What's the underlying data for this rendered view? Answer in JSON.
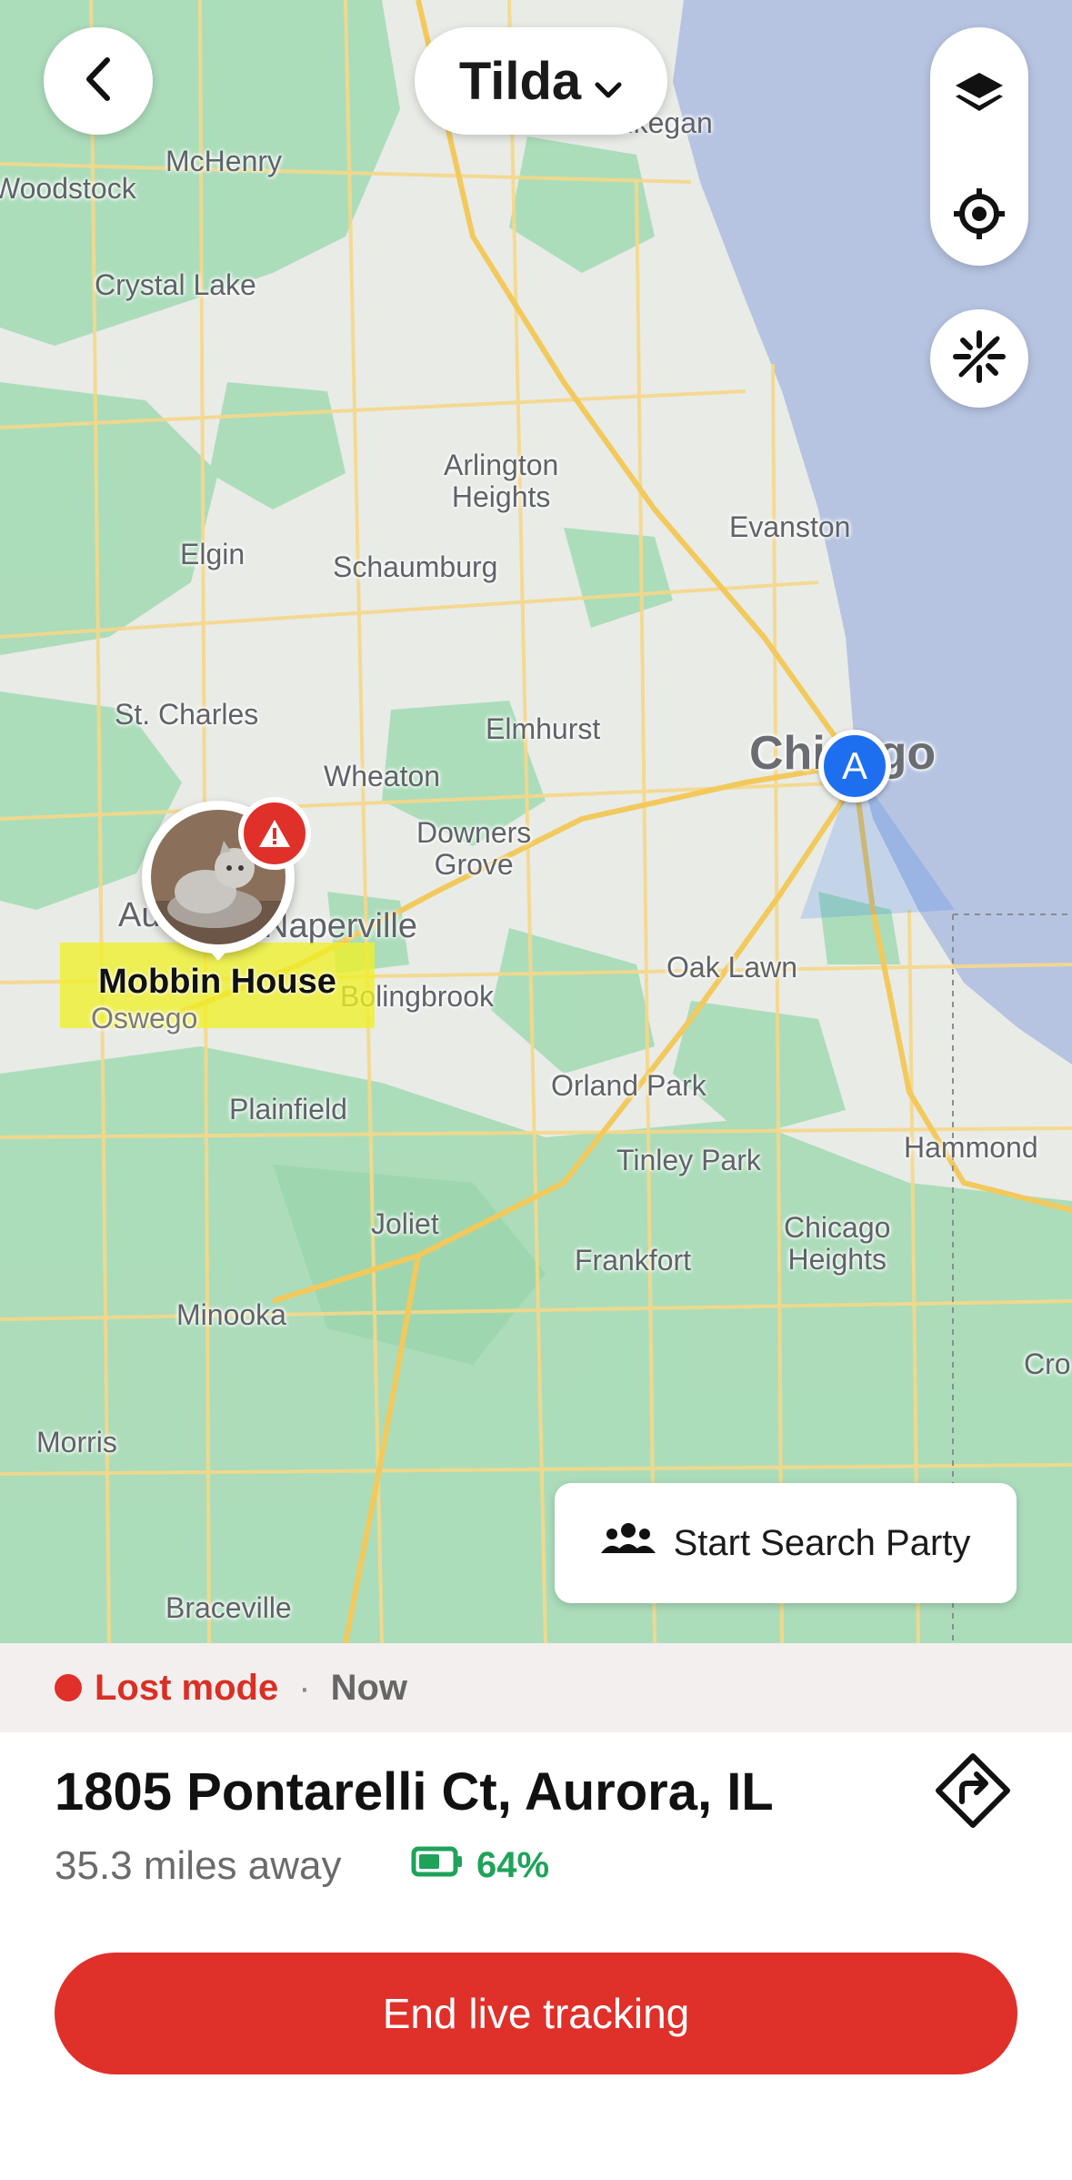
{
  "header": {
    "pet_name": "Tilda"
  },
  "map": {
    "places": {
      "waukegan": "Waukegan",
      "woodstock": "Woodstock",
      "mchenry": "McHenry",
      "crystal_lake": "Crystal Lake",
      "arlington_heights": "Arlington\nHeights",
      "evanston": "Evanston",
      "elgin": "Elgin",
      "schaumburg": "Schaumburg",
      "st_charles": "St. Charles",
      "elmhurst": "Elmhurst",
      "chicago": "Chicago",
      "wheaton": "Wheaton",
      "downers_grove": "Downers\nGrove",
      "aurora": "Au",
      "naperville": "Naperville",
      "bolingbrook": "Bolingbrook",
      "oswego": "Oswego",
      "oak_lawn": "Oak Lawn",
      "orland_park": "Orland Park",
      "plainfield": "Plainfield",
      "hammond": "Hammond",
      "tinley_park": "Tinley Park",
      "joliet": "Joliet",
      "chicago_heights": "Chicago\nHeights",
      "frankfort": "Frankfort",
      "minooka": "Minooka",
      "crown": "Cro",
      "morris": "Morris",
      "braceville": "Braceville"
    },
    "home_label": "Mobbin House",
    "owner_marker_letter": "A",
    "search_party_label": "Start Search Party"
  },
  "status": {
    "mode": "Lost mode",
    "separator": "·",
    "time": "Now"
  },
  "location": {
    "address": "1805 Pontarelli Ct, Aurora, IL",
    "distance": "35.3 miles away",
    "battery_percent": "64%",
    "battery_level": 0.64
  },
  "actions": {
    "end_tracking": "End live tracking"
  },
  "colors": {
    "alert_red": "#e0302a",
    "owner_blue": "#1e6ff0",
    "battery_green": "#1fa35a",
    "water": "#b6c4e2",
    "park_green": "#a9dcb8"
  }
}
